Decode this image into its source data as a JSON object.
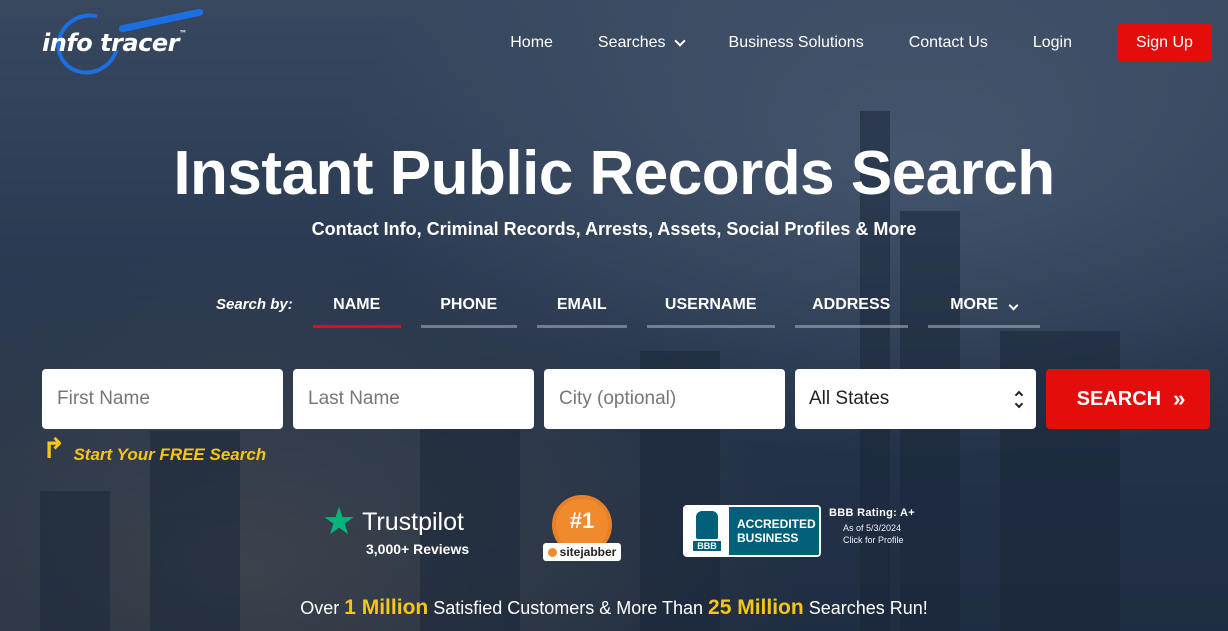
{
  "brand": {
    "logo_text": "info tracer",
    "logo_tm": "™"
  },
  "nav": {
    "items": [
      {
        "label": "Home"
      },
      {
        "label": "Searches"
      },
      {
        "label": "Business Solutions"
      },
      {
        "label": "Contact Us"
      },
      {
        "label": "Login"
      }
    ],
    "signup_label": "Sign Up"
  },
  "hero": {
    "title": "Instant Public Records Search",
    "subtitle": "Contact Info, Criminal Records, Arrests, Assets, Social Profiles & More"
  },
  "search_by": {
    "label": "Search by:",
    "tabs": [
      {
        "label": "NAME",
        "active": true
      },
      {
        "label": "PHONE"
      },
      {
        "label": "EMAIL"
      },
      {
        "label": "USERNAME"
      },
      {
        "label": "ADDRESS"
      },
      {
        "label": "MORE"
      }
    ]
  },
  "form": {
    "first_name_placeholder": "First Name",
    "last_name_placeholder": "Last Name",
    "city_placeholder": "City (optional)",
    "state_value": "All States",
    "search_label": "SEARCH",
    "search_chevrons": "»"
  },
  "free_search": {
    "arrow": "↰",
    "text": "Start Your FREE Search"
  },
  "badges": {
    "trustpilot": {
      "star": "★",
      "name": "Trustpilot",
      "reviews": "3,000+ Reviews"
    },
    "sitejabber": {
      "rank": "#1",
      "name": "sitejabber"
    },
    "bbb": {
      "letters": "BBB",
      "accredited_line1": "ACCREDITED",
      "accredited_line2": "BUSINESS",
      "rating": "BBB Rating: A+",
      "date": "As of 5/3/2024",
      "click": "Click for Profile"
    }
  },
  "tagline": {
    "part1": "Over ",
    "highlight1": "1 Million",
    "part2": " Satisfied Customers & More Than ",
    "highlight2": "25 Million",
    "part3": " Searches Run!"
  },
  "colors": {
    "accent_red": "#e50c0c",
    "highlight_yellow": "#f5c518",
    "brand_blue": "#1b6fe0",
    "trustpilot_green": "#00b67a",
    "bbb_teal": "#00607a",
    "sitejabber_orange": "#f08a2c"
  }
}
